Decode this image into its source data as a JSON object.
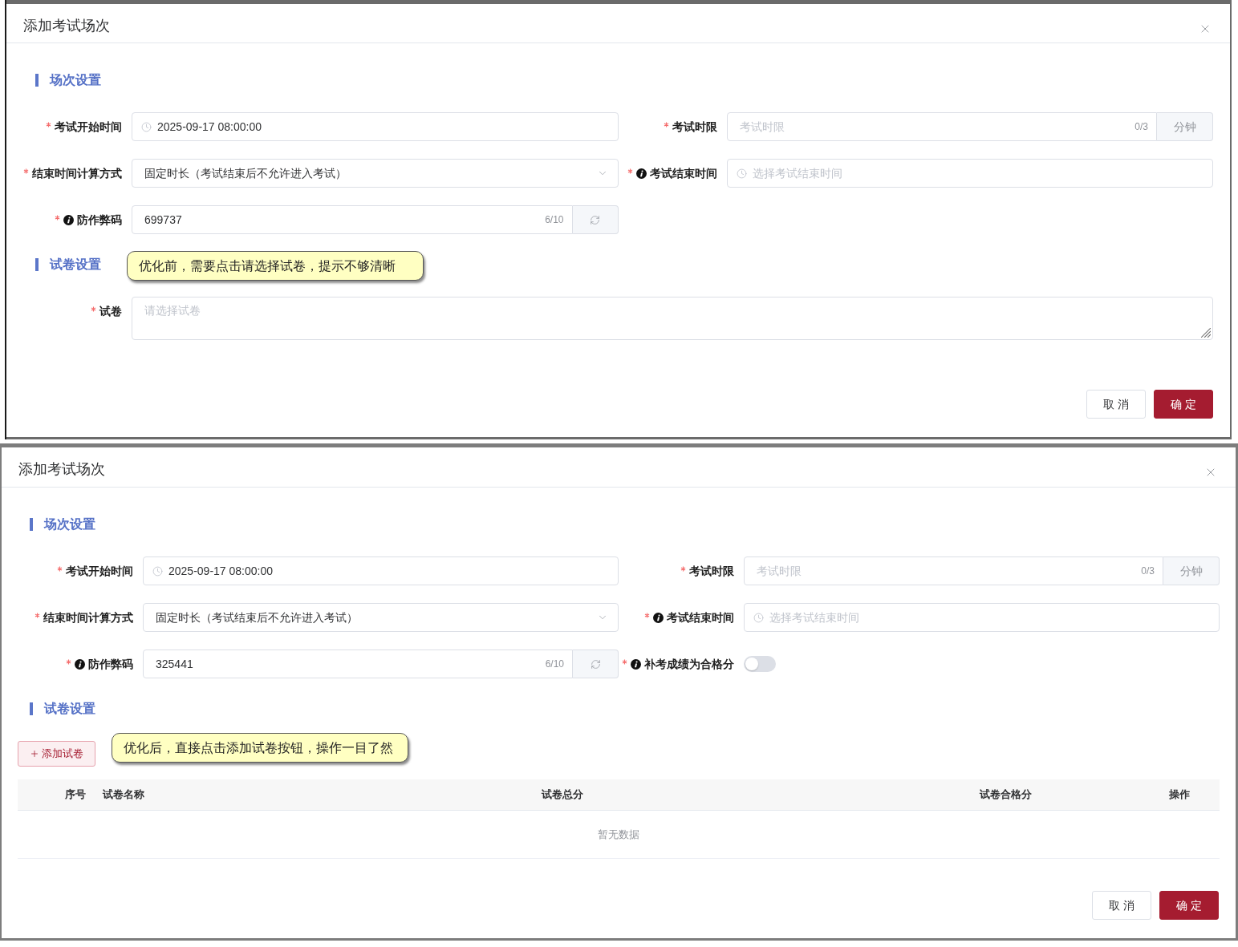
{
  "dialogs": [
    {
      "title": "添加考试场次",
      "sections": [
        {
          "title": "场次设置",
          "fields": [
            {
              "kind": "datetime",
              "label": "考试开始时间",
              "required": true,
              "info": false,
              "value": "2025-09-17 08:00:00"
            },
            {
              "kind": "number_unit",
              "label": "考试时限",
              "required": true,
              "info": false,
              "placeholder": "考试时限",
              "counter": "0/3",
              "unit": "分钟"
            },
            {
              "kind": "select",
              "label": "结束时间计算方式",
              "required": true,
              "info": false,
              "value": "固定时长（考试结束后不允许进入考试）"
            },
            {
              "kind": "datetime",
              "label": "考试结束时间",
              "required": true,
              "info": true,
              "placeholder": "选择考试结束时间"
            },
            {
              "kind": "code",
              "label": "防作弊码",
              "required": true,
              "info": true,
              "value": "699737",
              "counter": "6/10"
            }
          ]
        },
        {
          "title": "试卷设置",
          "note": "优化前，需要点击请选择试卷，提示不够清晰",
          "fields": [
            {
              "kind": "textarea",
              "label": "试卷",
              "required": true,
              "info": false,
              "placeholder": "请选择试卷"
            }
          ]
        }
      ],
      "buttons": [
        {
          "label": "取 消",
          "kind": "default"
        },
        {
          "label": "确 定",
          "kind": "primary"
        }
      ]
    },
    {
      "title": "添加考试场次",
      "sections": [
        {
          "title": "场次设置",
          "fields": [
            {
              "kind": "datetime",
              "label": "考试开始时间",
              "required": true,
              "info": false,
              "value": "2025-09-17 08:00:00"
            },
            {
              "kind": "number_unit",
              "label": "考试时限",
              "required": true,
              "info": false,
              "placeholder": "考试时限",
              "counter": "0/3",
              "unit": "分钟"
            },
            {
              "kind": "select",
              "label": "结束时间计算方式",
              "required": true,
              "info": false,
              "value": "固定时长（考试结束后不允许进入考试）"
            },
            {
              "kind": "datetime",
              "label": "考试结束时间",
              "required": true,
              "info": true,
              "placeholder": "选择考试结束时间"
            },
            {
              "kind": "code",
              "label": "防作弊码",
              "required": true,
              "info": true,
              "value": "325441",
              "counter": "6/10"
            },
            {
              "kind": "switch",
              "label": "补考成绩为合格分",
              "required": true,
              "info": true,
              "on": false
            }
          ]
        },
        {
          "title": "试卷设置",
          "add_button": "添加试卷",
          "note": "优化后，直接点击添加试卷按钮，操作一目了然",
          "table": {
            "columns": [
              "序号",
              "试卷名称",
              "试卷总分",
              "试卷合格分",
              "操作"
            ],
            "empty_text": "暂无数据"
          }
        }
      ],
      "buttons": [
        {
          "label": "取 消",
          "kind": "default"
        },
        {
          "label": "确 定",
          "kind": "primary"
        }
      ]
    }
  ]
}
